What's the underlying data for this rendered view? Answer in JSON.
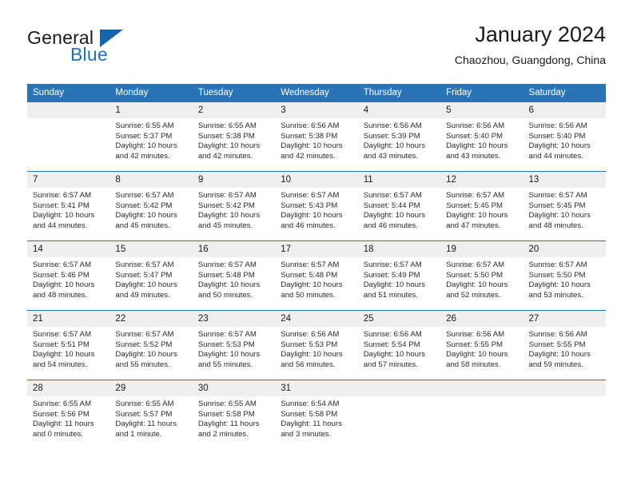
{
  "brand": {
    "name_part1": "General",
    "name_part2": "Blue",
    "accent_color": "#2272b8",
    "triangle_color": "#1565a8"
  },
  "header": {
    "title": "January 2024",
    "subtitle": "Chaozhou, Guangdong, China"
  },
  "theme": {
    "header_blue": "#2a74b6",
    "date_band_gray": "#efefef"
  },
  "calendar": {
    "day_headers": [
      "Sunday",
      "Monday",
      "Tuesday",
      "Wednesday",
      "Thursday",
      "Friday",
      "Saturday"
    ],
    "weeks": [
      [
        {
          "day": "",
          "lines": []
        },
        {
          "day": "1",
          "lines": [
            "Sunrise: 6:55 AM",
            "Sunset: 5:37 PM",
            "Daylight: 10 hours",
            "and 42 minutes."
          ]
        },
        {
          "day": "2",
          "lines": [
            "Sunrise: 6:55 AM",
            "Sunset: 5:38 PM",
            "Daylight: 10 hours",
            "and 42 minutes."
          ]
        },
        {
          "day": "3",
          "lines": [
            "Sunrise: 6:56 AM",
            "Sunset: 5:38 PM",
            "Daylight: 10 hours",
            "and 42 minutes."
          ]
        },
        {
          "day": "4",
          "lines": [
            "Sunrise: 6:56 AM",
            "Sunset: 5:39 PM",
            "Daylight: 10 hours",
            "and 43 minutes."
          ]
        },
        {
          "day": "5",
          "lines": [
            "Sunrise: 6:56 AM",
            "Sunset: 5:40 PM",
            "Daylight: 10 hours",
            "and 43 minutes."
          ]
        },
        {
          "day": "6",
          "lines": [
            "Sunrise: 6:56 AM",
            "Sunset: 5:40 PM",
            "Daylight: 10 hours",
            "and 44 minutes."
          ]
        }
      ],
      [
        {
          "day": "7",
          "lines": [
            "Sunrise: 6:57 AM",
            "Sunset: 5:41 PM",
            "Daylight: 10 hours",
            "and 44 minutes."
          ]
        },
        {
          "day": "8",
          "lines": [
            "Sunrise: 6:57 AM",
            "Sunset: 5:42 PM",
            "Daylight: 10 hours",
            "and 45 minutes."
          ]
        },
        {
          "day": "9",
          "lines": [
            "Sunrise: 6:57 AM",
            "Sunset: 5:42 PM",
            "Daylight: 10 hours",
            "and 45 minutes."
          ]
        },
        {
          "day": "10",
          "lines": [
            "Sunrise: 6:57 AM",
            "Sunset: 5:43 PM",
            "Daylight: 10 hours",
            "and 46 minutes."
          ]
        },
        {
          "day": "11",
          "lines": [
            "Sunrise: 6:57 AM",
            "Sunset: 5:44 PM",
            "Daylight: 10 hours",
            "and 46 minutes."
          ]
        },
        {
          "day": "12",
          "lines": [
            "Sunrise: 6:57 AM",
            "Sunset: 5:45 PM",
            "Daylight: 10 hours",
            "and 47 minutes."
          ]
        },
        {
          "day": "13",
          "lines": [
            "Sunrise: 6:57 AM",
            "Sunset: 5:45 PM",
            "Daylight: 10 hours",
            "and 48 minutes."
          ]
        }
      ],
      [
        {
          "day": "14",
          "lines": [
            "Sunrise: 6:57 AM",
            "Sunset: 5:46 PM",
            "Daylight: 10 hours",
            "and 48 minutes."
          ]
        },
        {
          "day": "15",
          "lines": [
            "Sunrise: 6:57 AM",
            "Sunset: 5:47 PM",
            "Daylight: 10 hours",
            "and 49 minutes."
          ]
        },
        {
          "day": "16",
          "lines": [
            "Sunrise: 6:57 AM",
            "Sunset: 5:48 PM",
            "Daylight: 10 hours",
            "and 50 minutes."
          ]
        },
        {
          "day": "17",
          "lines": [
            "Sunrise: 6:57 AM",
            "Sunset: 5:48 PM",
            "Daylight: 10 hours",
            "and 50 minutes."
          ]
        },
        {
          "day": "18",
          "lines": [
            "Sunrise: 6:57 AM",
            "Sunset: 5:49 PM",
            "Daylight: 10 hours",
            "and 51 minutes."
          ]
        },
        {
          "day": "19",
          "lines": [
            "Sunrise: 6:57 AM",
            "Sunset: 5:50 PM",
            "Daylight: 10 hours",
            "and 52 minutes."
          ]
        },
        {
          "day": "20",
          "lines": [
            "Sunrise: 6:57 AM",
            "Sunset: 5:50 PM",
            "Daylight: 10 hours",
            "and 53 minutes."
          ]
        }
      ],
      [
        {
          "day": "21",
          "lines": [
            "Sunrise: 6:57 AM",
            "Sunset: 5:51 PM",
            "Daylight: 10 hours",
            "and 54 minutes."
          ]
        },
        {
          "day": "22",
          "lines": [
            "Sunrise: 6:57 AM",
            "Sunset: 5:52 PM",
            "Daylight: 10 hours",
            "and 55 minutes."
          ]
        },
        {
          "day": "23",
          "lines": [
            "Sunrise: 6:57 AM",
            "Sunset: 5:53 PM",
            "Daylight: 10 hours",
            "and 55 minutes."
          ]
        },
        {
          "day": "24",
          "lines": [
            "Sunrise: 6:56 AM",
            "Sunset: 5:53 PM",
            "Daylight: 10 hours",
            "and 56 minutes."
          ]
        },
        {
          "day": "25",
          "lines": [
            "Sunrise: 6:56 AM",
            "Sunset: 5:54 PM",
            "Daylight: 10 hours",
            "and 57 minutes."
          ]
        },
        {
          "day": "26",
          "lines": [
            "Sunrise: 6:56 AM",
            "Sunset: 5:55 PM",
            "Daylight: 10 hours",
            "and 58 minutes."
          ]
        },
        {
          "day": "27",
          "lines": [
            "Sunrise: 6:56 AM",
            "Sunset: 5:55 PM",
            "Daylight: 10 hours",
            "and 59 minutes."
          ]
        }
      ],
      [
        {
          "day": "28",
          "lines": [
            "Sunrise: 6:55 AM",
            "Sunset: 5:56 PM",
            "Daylight: 11 hours",
            "and 0 minutes."
          ]
        },
        {
          "day": "29",
          "lines": [
            "Sunrise: 6:55 AM",
            "Sunset: 5:57 PM",
            "Daylight: 11 hours",
            "and 1 minute."
          ]
        },
        {
          "day": "30",
          "lines": [
            "Sunrise: 6:55 AM",
            "Sunset: 5:58 PM",
            "Daylight: 11 hours",
            "and 2 minutes."
          ]
        },
        {
          "day": "31",
          "lines": [
            "Sunrise: 6:54 AM",
            "Sunset: 5:58 PM",
            "Daylight: 11 hours",
            "and 3 minutes."
          ]
        },
        {
          "day": "",
          "lines": []
        },
        {
          "day": "",
          "lines": []
        },
        {
          "day": "",
          "lines": []
        }
      ]
    ]
  }
}
